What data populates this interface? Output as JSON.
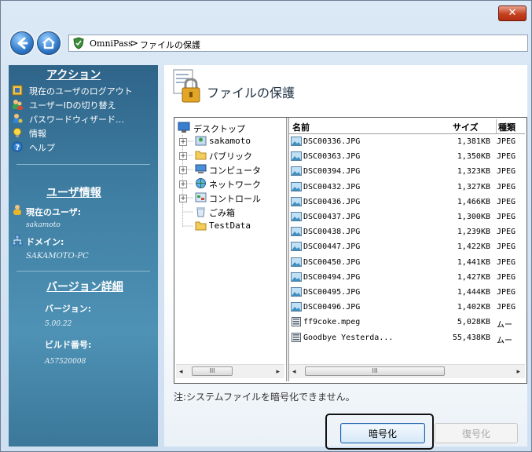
{
  "window": {
    "close_glyph": "✕"
  },
  "nav": {
    "address_app": "OmniPass",
    "address_sep": ">",
    "address_page": "ファイルの保護"
  },
  "sidebar": {
    "actions_header": "アクション",
    "actions": [
      {
        "label": "現在のユーザのログアウト",
        "icon": "logout-user-icon"
      },
      {
        "label": "ユーザーIDの切り替え",
        "icon": "switch-user-icon"
      },
      {
        "label": "パスワードウィザード…",
        "icon": "password-wizard-icon"
      },
      {
        "label": "情報",
        "icon": "info-bulb-icon"
      },
      {
        "label": "ヘルプ",
        "icon": "help-icon"
      }
    ],
    "user_header": "ユーザ情報",
    "current_user_label": "現在のユーザ:",
    "current_user_value": "sakamoto",
    "domain_label": "ドメイン:",
    "domain_value": "SAKAMOTO-PC",
    "version_header": "バージョン詳細",
    "version_label": "バージョン:",
    "version_value": "5.00.22",
    "build_label": "ビルド番号:",
    "build_value": "A57520008"
  },
  "main": {
    "title": "ファイルの保護",
    "note": "注:システムファイルを暗号化できません。",
    "encrypt_label": "暗号化",
    "decrypt_label": "復号化"
  },
  "tree": {
    "root": "デスクトップ",
    "items": [
      "sakamoto",
      "パブリック",
      "コンピュータ",
      "ネットワーク",
      "コントロール",
      "ごみ箱",
      "TestData"
    ]
  },
  "files": {
    "columns": {
      "name": "名前",
      "size": "サイズ",
      "type": "種類"
    },
    "rows": [
      {
        "name": "DSC00336.JPG",
        "size": "1,381KB",
        "type": "JPEG"
      },
      {
        "name": "DSC00363.JPG",
        "size": "1,350KB",
        "type": "JPEG"
      },
      {
        "name": "DSC00394.JPG",
        "size": "1,323KB",
        "type": "JPEG"
      },
      {
        "name": "DSC00432.JPG",
        "size": "1,327KB",
        "type": "JPEG"
      },
      {
        "name": "DSC00436.JPG",
        "size": "1,466KB",
        "type": "JPEG"
      },
      {
        "name": "DSC00437.JPG",
        "size": "1,300KB",
        "type": "JPEG"
      },
      {
        "name": "DSC00438.JPG",
        "size": "1,239KB",
        "type": "JPEG"
      },
      {
        "name": "DSC00447.JPG",
        "size": "1,422KB",
        "type": "JPEG"
      },
      {
        "name": "DSC00450.JPG",
        "size": "1,441KB",
        "type": "JPEG"
      },
      {
        "name": "DSC00494.JPG",
        "size": "1,427KB",
        "type": "JPEG"
      },
      {
        "name": "DSC00495.JPG",
        "size": "1,444KB",
        "type": "JPEG"
      },
      {
        "name": "DSC00496.JPG",
        "size": "1,402KB",
        "type": "JPEG"
      },
      {
        "name": "ff9coke.mpeg",
        "size": "5,028KB",
        "type": "ムー"
      },
      {
        "name": "Goodbye Yesterda...",
        "size": "55,438KB",
        "type": "ムー"
      }
    ]
  },
  "scroll": {
    "left_arrow": "◂",
    "right_arrow": "▸",
    "thumb_grip": "III"
  }
}
